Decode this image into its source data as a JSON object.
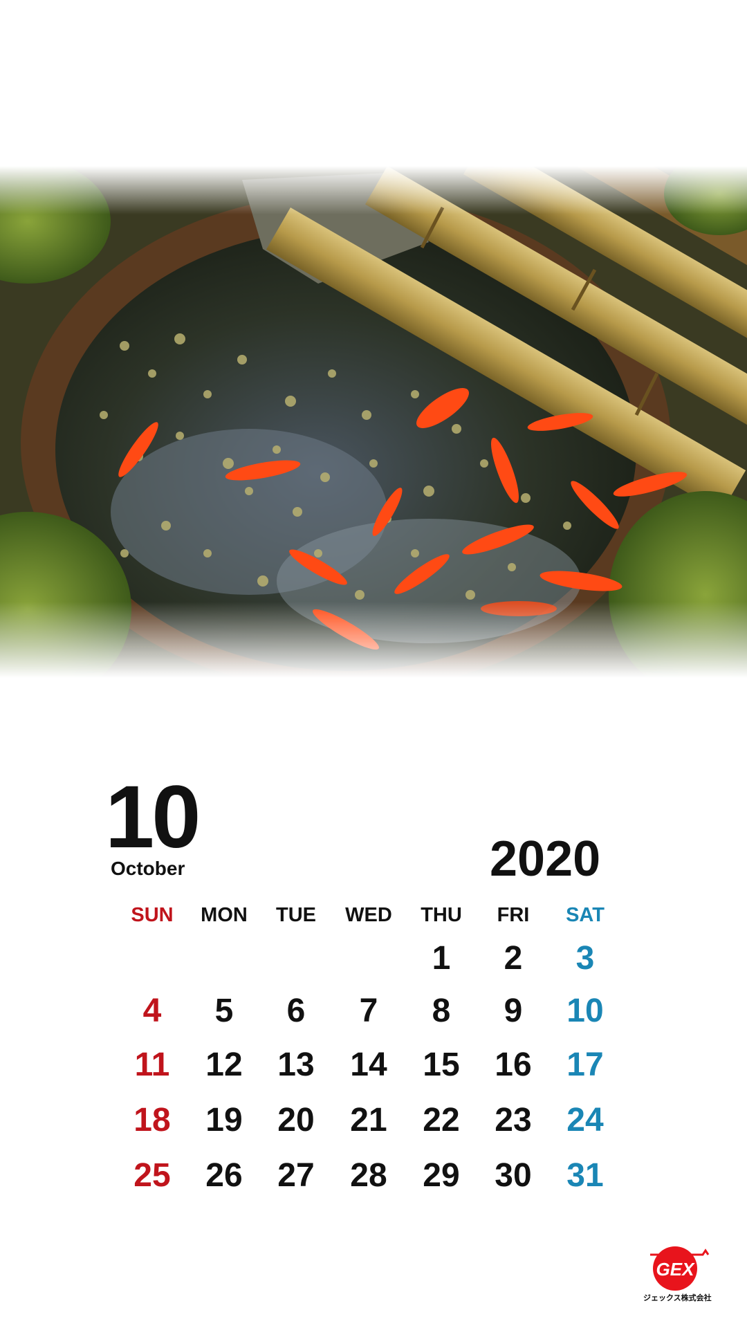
{
  "calendar": {
    "month_number": "10",
    "month_name": "October",
    "year": "2020",
    "weekdays": [
      "SUN",
      "MON",
      "TUE",
      "WED",
      "THU",
      "FRI",
      "SAT"
    ],
    "weeks": [
      [
        "",
        "",
        "",
        "",
        "1",
        "2",
        "3"
      ],
      [
        "4",
        "5",
        "6",
        "7",
        "8",
        "9",
        "10"
      ],
      [
        "11",
        "12",
        "13",
        "14",
        "15",
        "16",
        "17"
      ],
      [
        "18",
        "19",
        "20",
        "21",
        "22",
        "23",
        "24"
      ],
      [
        "25",
        "26",
        "27",
        "28",
        "29",
        "30",
        "31"
      ]
    ]
  },
  "colors": {
    "sunday": "#c0141c",
    "saturday": "#1a86b5",
    "text": "#111111",
    "logo_red": "#e8141c"
  },
  "logo": {
    "brand": "GEX",
    "company": "ジェックス株式会社"
  }
}
